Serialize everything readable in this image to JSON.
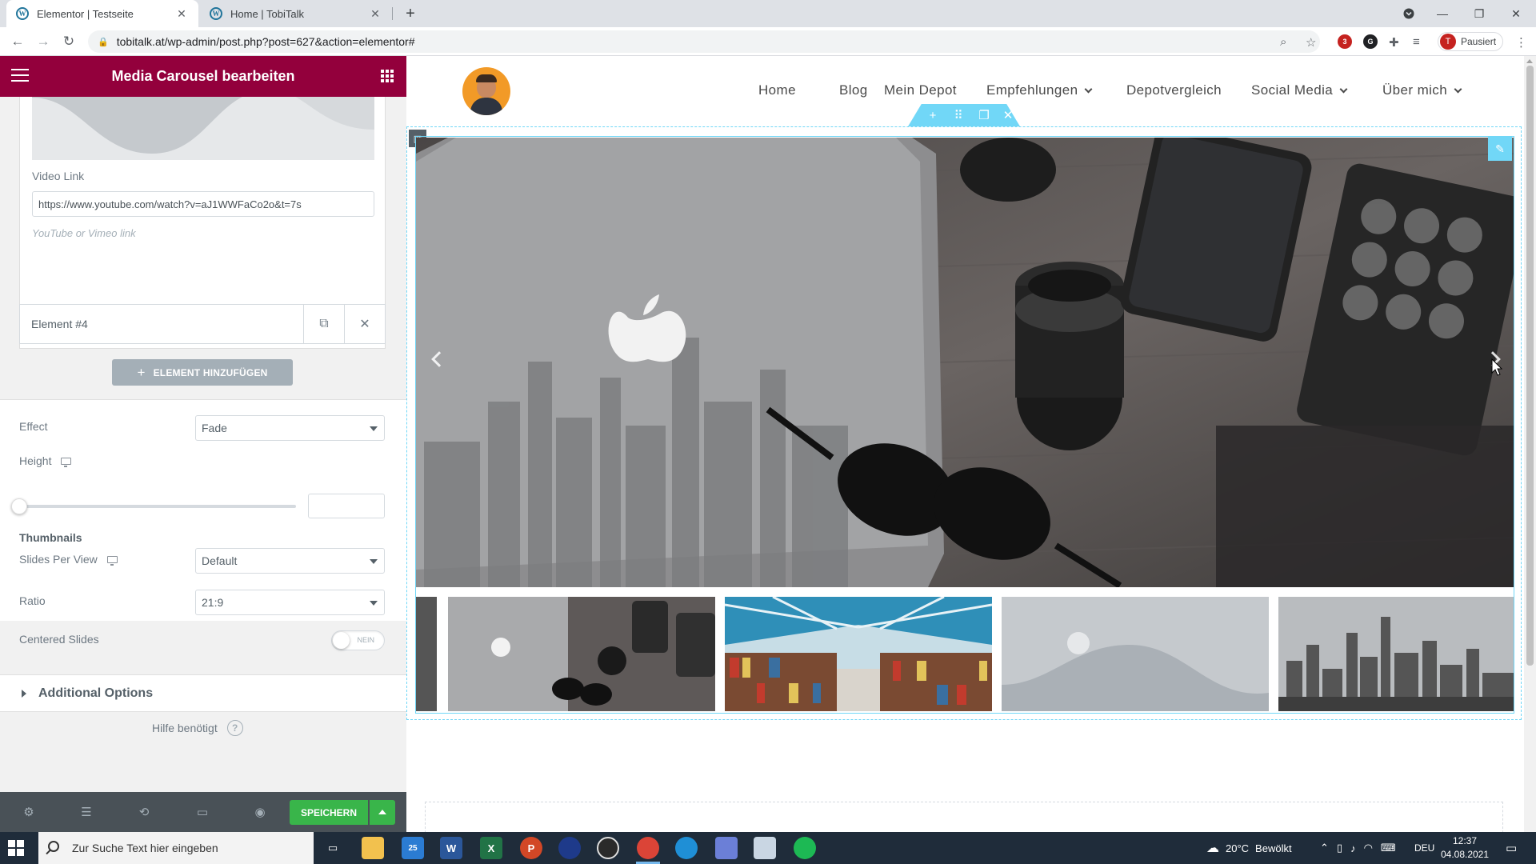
{
  "browser": {
    "tabs": [
      {
        "title": "Elementor | Testseite",
        "active": true
      },
      {
        "title": "Home | TobiTalk",
        "active": false
      }
    ],
    "url": "tobitalk.at/wp-admin/post.php?post=627&action=elementor#",
    "profile_label": "Pausiert",
    "profile_initial": "T",
    "extension_badge": "3",
    "icons": {
      "back": "arrow-left-icon",
      "forward": "arrow-right-icon",
      "reload": "reload-icon",
      "lock": "lock-icon",
      "zoom": "zoom-icon",
      "star": "star-icon",
      "puzzle": "extensions-icon",
      "menu": "kebab-menu-icon"
    }
  },
  "panel": {
    "title": "Media Carousel bearbeiten",
    "video_link_label": "Video Link",
    "video_link_value": "https://www.youtube.com/watch?v=aJ1WWFaCo2o&t=7s",
    "video_link_hint": "YouTube or Vimeo link",
    "item_title": "Element #4",
    "add_item_label": "ELEMENT HINZUFÜGEN",
    "effect_label": "Effect",
    "effect_value": "Fade",
    "height_label": "Height",
    "height_value": 0,
    "thumbnails_heading": "Thumbnails",
    "slides_per_view_label": "Slides Per View",
    "slides_per_view_value": "Default",
    "ratio_label": "Ratio",
    "ratio_value": "21:9",
    "centered_slides_label": "Centered Slides",
    "centered_slides_toggle": "NEIN",
    "additional_options_label": "Additional Options",
    "help_label": "Hilfe benötigt",
    "save_label": "SPEICHERN",
    "accent_color": "#93003c",
    "save_color": "#39b54a"
  },
  "site": {
    "nav": [
      {
        "label": "Home",
        "dropdown": false
      },
      {
        "label": "Blog",
        "dropdown": false
      },
      {
        "label": "Mein Depot",
        "dropdown": false
      },
      {
        "label": "Empfehlungen",
        "dropdown": true
      },
      {
        "label": "Depotvergleich",
        "dropdown": false
      },
      {
        "label": "Social Media",
        "dropdown": true
      },
      {
        "label": "Über mich",
        "dropdown": true
      }
    ],
    "editor_accent": "#71d7f7"
  },
  "taskbar": {
    "search_placeholder": "Zur Suche Text hier eingeben",
    "mail_badge": "25",
    "weather_temp": "20°C",
    "weather_text": "Bewölkt",
    "language": "DEU",
    "time": "12:37",
    "date": "04.08.2021"
  }
}
